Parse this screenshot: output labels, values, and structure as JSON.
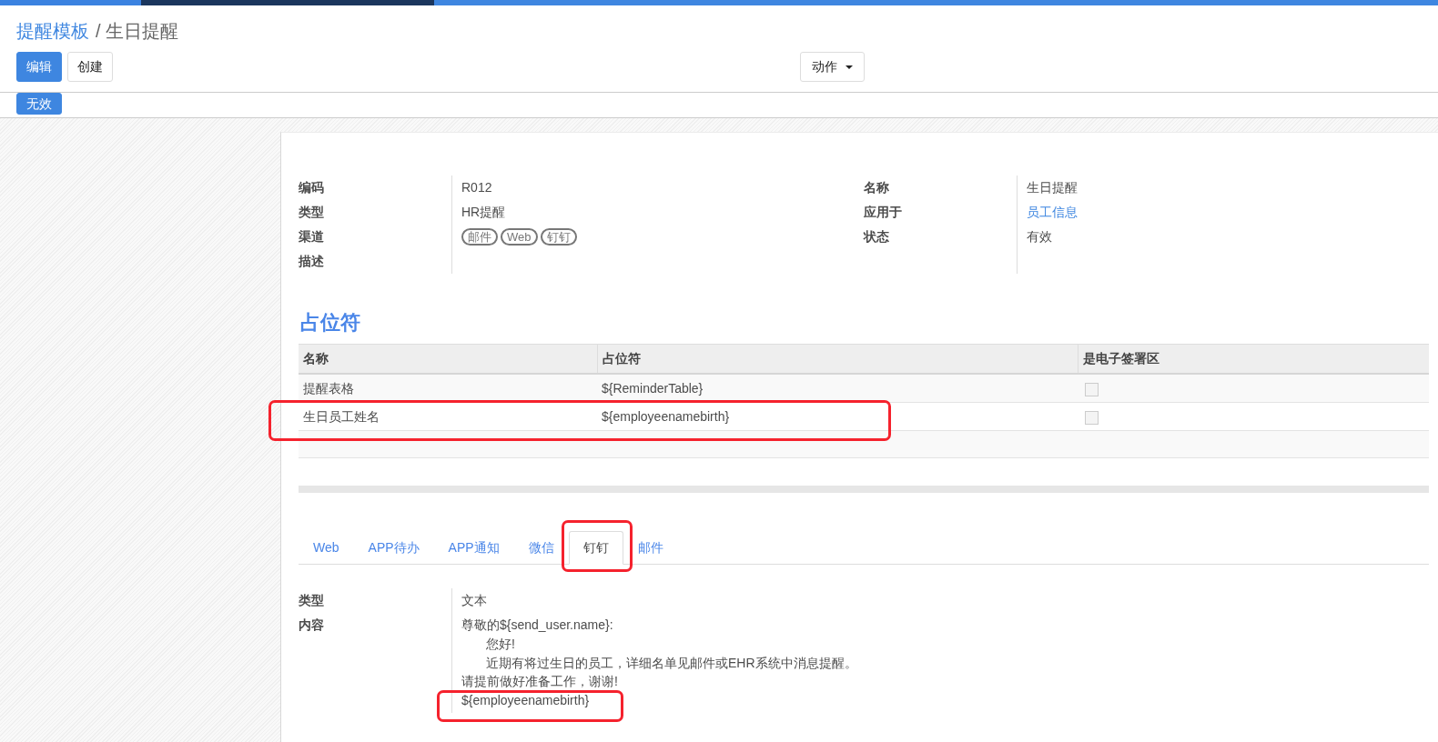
{
  "breadcrumb": {
    "items": [
      {
        "text": "提醒模板",
        "kind": "link"
      },
      {
        "text": "生日提醒",
        "kind": "current"
      }
    ],
    "separator": "/"
  },
  "buttons": [
    {
      "label": "编辑",
      "kind": "primary"
    },
    {
      "label": "创建",
      "kind": "secondary"
    }
  ],
  "action_menu": {
    "label": "动作"
  },
  "status_buttons": [
    {
      "label": "无效"
    }
  ],
  "form": {
    "groups": [
      {
        "fields": [
          {
            "label": "编码",
            "kind": "text",
            "value": "R012"
          },
          {
            "label": "类型",
            "kind": "text",
            "value": "HR提醒"
          },
          {
            "label": "渠道",
            "kind": "tags",
            "tags": [
              "邮件",
              "Web",
              "钉钉"
            ]
          },
          {
            "label": "描述",
            "kind": "empty"
          }
        ]
      },
      {
        "fields": [
          {
            "label": "名称",
            "kind": "text",
            "value": "生日提醒"
          },
          {
            "label": "应用于",
            "kind": "link",
            "value": "员工信息"
          },
          {
            "label": "状态",
            "kind": "text",
            "value": "有效"
          }
        ]
      }
    ]
  },
  "placeholders": {
    "title": "占位符",
    "columns": [
      "名称",
      "占位符",
      "是电子签署区"
    ],
    "rows": [
      {
        "name": "提醒表格",
        "placeholder": "${ReminderTable}",
        "checked": false,
        "highlighted": false
      },
      {
        "name": "生日员工姓名",
        "placeholder": "${employeenamebirth}",
        "checked": false,
        "highlighted": true
      }
    ]
  },
  "tabs": [
    {
      "label": "Web",
      "selected": false,
      "highlighted": false
    },
    {
      "label": "APP待办",
      "selected": false,
      "highlighted": false
    },
    {
      "label": "APP通知",
      "selected": false,
      "highlighted": false
    },
    {
      "label": "微信",
      "selected": false,
      "highlighted": false
    },
    {
      "label": "钉钉",
      "selected": true,
      "highlighted": true
    },
    {
      "label": "邮件",
      "selected": false,
      "highlighted": false
    }
  ],
  "tab_content": {
    "fields": [
      {
        "label": "类型",
        "kind": "text",
        "value": "文本"
      },
      {
        "label": "内容",
        "kind": "lines",
        "lines": [
          {
            "text": "尊敬的${send_user.name}:",
            "indented": false,
            "highlighted": false
          },
          {
            "text": "您好!",
            "indented": true,
            "highlighted": false
          },
          {
            "text": "近期有将过生日的员工，详细名单见邮件或EHR系统中消息提醒。",
            "indented": true,
            "highlighted": false
          },
          {
            "text": "请提前做好准备工作，谢谢!",
            "indented": false,
            "highlighted": false
          },
          {
            "text": "${employeenamebirth}",
            "indented": false,
            "highlighted": true
          }
        ]
      }
    ]
  }
}
